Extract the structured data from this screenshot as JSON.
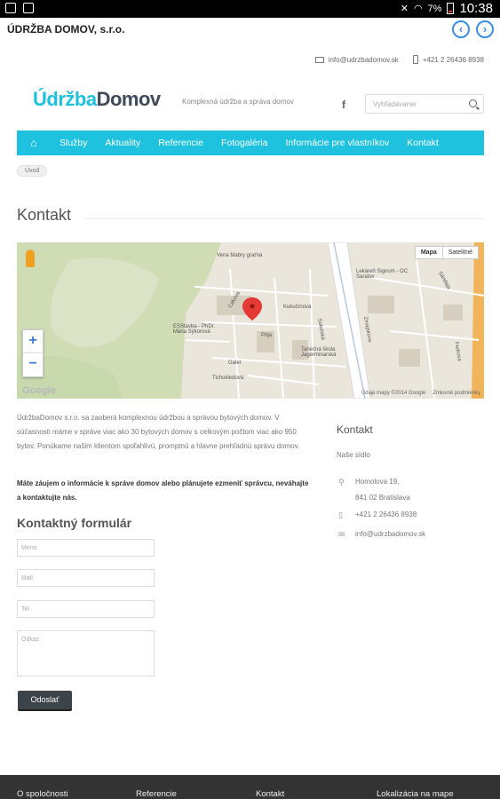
{
  "status_bar": {
    "battery": "7%",
    "time": "10:38"
  },
  "app": {
    "title": "ÚDRŽBA DOMOV, s.r.o.",
    "back_icon": "chevron-left-icon",
    "forward_icon": "chevron-right-icon"
  },
  "top_contact": {
    "email": "info@udrzbadomov.sk",
    "phone": "+421 2 26436 8938"
  },
  "logo": {
    "part1": "Údržba",
    "part2": "Domov"
  },
  "tagline": "Komplexná údržba a správa domov",
  "search": {
    "placeholder": "Vyhľadávanie"
  },
  "nav": {
    "home_icon": "home-icon",
    "items": [
      "Služby",
      "Aktuality",
      "Referencie",
      "Fotogaléria",
      "Informácie pre vlastníkov",
      "Kontakt"
    ]
  },
  "breadcrumb": "Úvod",
  "page_title": "Kontakt",
  "map": {
    "types": [
      "Mapa",
      "Satelitné"
    ],
    "zoom_in": "+",
    "zoom_out": "−",
    "google": "Google",
    "attribution": "Údaje mapy ©2014 Google",
    "terms": "Zmluvné podmienky",
    "labels": [
      "Lekáreň Signum - OC Saratov",
      "ESStavba - PhDr. Mária Sýkorová",
      "Tanečná škola Jagerminarská",
      "Vena Mabry graťná",
      "Cákova",
      "Kukučínová",
      "Zmajskova",
      "Sándaja",
      "Sokolská",
      "Prija",
      "Tichokledová",
      "Fedrova",
      "Galer"
    ]
  },
  "intro_text": "ÚdržbaDomov s.r.o. sa zaoberá komplexnou údržbou a správou bytových domov. V súčasnosti máme v správe viac ako 30 bytových domov s celkovým počtom viac ako 950 bytov. Ponúkame našim klientom spoľahlivú, promptnú a hlavne prehľadnú správu domov.",
  "cta_text": "Máte záujem o informácie k správe domov alebo plánujete ezmeniť správcu, neváhajte a kontaktujte nás.",
  "form": {
    "title": "Kontaktný formulár",
    "name_placeholder": "Meno",
    "mail_placeholder": "Mail",
    "phone_placeholder": "Tel",
    "message_placeholder": "Odkaz",
    "send_label": "Odoslať"
  },
  "sidebar": {
    "title": "Kontakt",
    "subtitle": "Naše sídlo",
    "address_line1": "Homolova 19,",
    "address_line2": "841 02 Bratislava",
    "phone": "+421 2 26436 8938",
    "email": "info@udrzbadomov.sk"
  },
  "footer": {
    "items": [
      "O spoločnosti",
      "Referencie",
      "Kontakt",
      "Lokalizácia na mape"
    ]
  },
  "colors": {
    "accent": "#1ec2de",
    "logo_dark": "#3f4a5a",
    "footer_bg": "#333333",
    "button_bg": "#3d4449"
  }
}
